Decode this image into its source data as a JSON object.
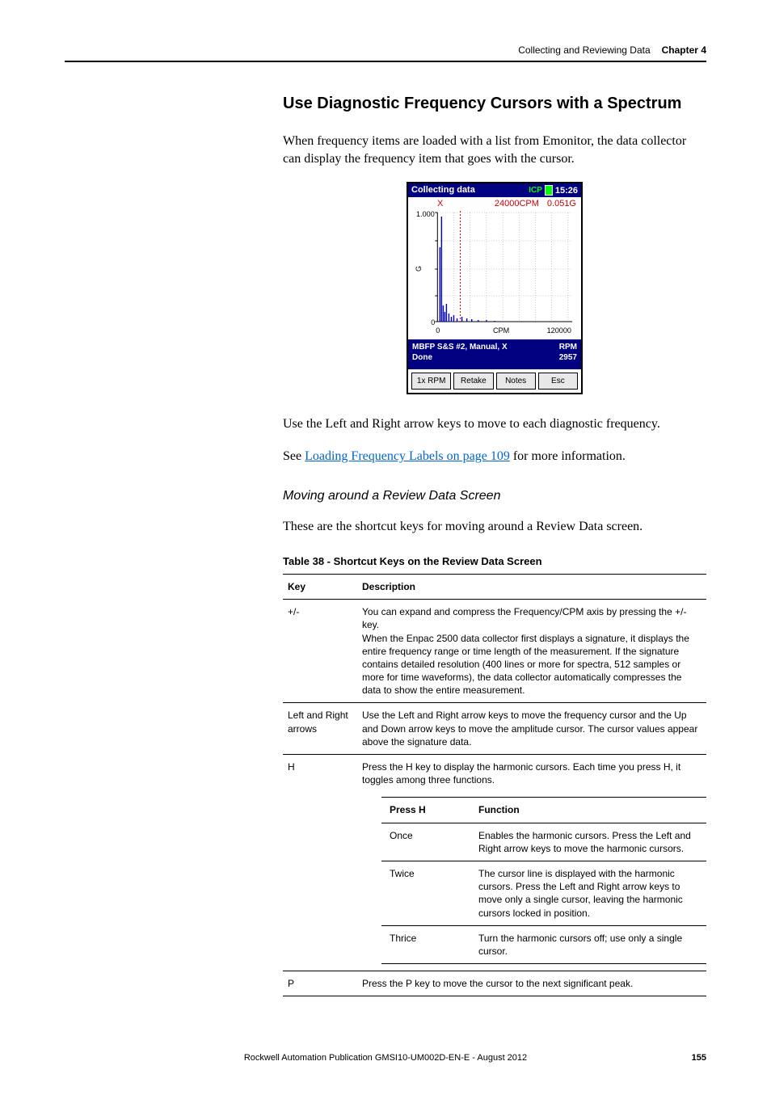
{
  "header": {
    "chapter_title": "Collecting and Reviewing Data",
    "chapter_label": "Chapter 4"
  },
  "section": {
    "title": "Use Diagnostic Frequency Cursors with a Spectrum",
    "intro": "When frequency items are loaded with a list from Emonitor, the data collector can display the frequency item that goes with the cursor.",
    "after_device": "Use the Left and Right arrow keys to move to each diagnostic frequency.",
    "see_prefix": "See ",
    "see_link": "Loading Frequency Labels on page 109",
    "see_suffix": " for more information."
  },
  "device": {
    "title": "Collecting data",
    "icp": "ICP",
    "time": "15:26",
    "readout_x": "X",
    "readout_freq": "24000CPM",
    "readout_amp": "0.051G",
    "y_max": "1.000",
    "y_unit": "G",
    "y_min": "0",
    "x_min": "0",
    "x_label": "CPM",
    "x_max": "120000",
    "status_line1": "MBFP S&S #2, Manual, X",
    "status_line2": "Done",
    "status_rpm_label": "RPM",
    "status_rpm_value": "2957",
    "buttons": [
      "1x RPM",
      "Retake",
      "Notes",
      "Esc"
    ]
  },
  "subsection": {
    "heading": "Moving around a Review Data Screen",
    "intro": "These are the shortcut keys for moving around a Review Data screen."
  },
  "table": {
    "caption": "Table 38 - Shortcut Keys on the Review Data Screen",
    "head_key": "Key",
    "head_desc": "Description",
    "rows": {
      "r0": {
        "key": "+/-",
        "desc": "You can expand and compress the Frequency/CPM axis by pressing the +/- key.\nWhen the Enpac 2500 data collector first displays a signature, it displays the entire frequency range or time length of the measurement. If the signature contains detailed resolution (400 lines or more for spectra, 512 samples or more for time waveforms), the data collector automatically compresses the data to show the entire measurement."
      },
      "r1": {
        "key": "Left and Right arrows",
        "desc": "Use the Left and Right arrow keys to move the frequency cursor and the Up and Down arrow keys to move the amplitude cursor. The cursor values appear above the signature data."
      },
      "r2": {
        "key": "H",
        "desc": "Press the H key to display the harmonic cursors. Each time you press H, it toggles among three functions."
      },
      "r3": {
        "key": "P",
        "desc": "Press the P key to move the cursor to the next significant peak."
      }
    },
    "inner": {
      "head_press": "Press H",
      "head_func": "Function",
      "rows": {
        "i0": {
          "press": "Once",
          "func": "Enables the harmonic cursors. Press the Left and Right arrow keys to move the harmonic cursors."
        },
        "i1": {
          "press": "Twice",
          "func": "The cursor line is displayed with the harmonic cursors. Press the Left and Right arrow keys to move only a single cursor, leaving the harmonic cursors locked in position."
        },
        "i2": {
          "press": "Thrice",
          "func": "Turn the harmonic cursors off; use only a single cursor."
        }
      }
    }
  },
  "footer": {
    "publication": "Rockwell Automation Publication GMSI10-UM002D-EN-E - August 2012",
    "page": "155"
  }
}
